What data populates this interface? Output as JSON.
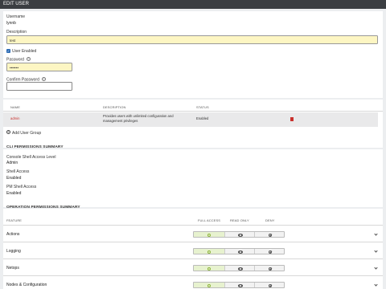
{
  "header": {
    "title": "EDIT USER"
  },
  "user": {
    "username_label": "Username",
    "username_value": "lynnb",
    "description_label": "Description",
    "description_value": "test",
    "enabled_label": "User Enabled",
    "password_label": "Password",
    "password_value": "•••••••",
    "confirm_label": "Confirm Password",
    "confirm_value": ""
  },
  "groups_table": {
    "columns": [
      "NAME",
      "DESCRIPTION",
      "STATUS"
    ],
    "rows": [
      {
        "name": "admin",
        "description": "Provides users with unlimited configuration and management privileges",
        "status": "Enabled"
      }
    ],
    "add_label": "Add User Group"
  },
  "cli": {
    "title": "CLI PERMISSIONS SUMMARY",
    "console_label": "Console Shell Access Level",
    "console_value": "Admin",
    "shell_label": "Shell Access",
    "shell_value": "Enabled",
    "pm_label": "PM Shell Access",
    "pm_value": "Enabled"
  },
  "ops": {
    "title": "OPERATION PERMISSIONS SUMMARY",
    "columns": [
      "FEATURE",
      "FULL ACCESS",
      "READ ONLY",
      "DENY"
    ],
    "rows": [
      {
        "feature": "Actions",
        "selected": "FULL ACCESS"
      },
      {
        "feature": "Logging",
        "selected": "FULL ACCESS"
      },
      {
        "feature": "Netops",
        "selected": "FULL ACCESS"
      },
      {
        "feature": "Nodes & Configuration",
        "selected": "FULL ACCESS"
      }
    ]
  },
  "colors": {
    "header_bg": "#3b3e42",
    "accent_red": "#c9302c",
    "checkbox_blue": "#2f6db5",
    "full_access_green": "#8cb43a"
  }
}
